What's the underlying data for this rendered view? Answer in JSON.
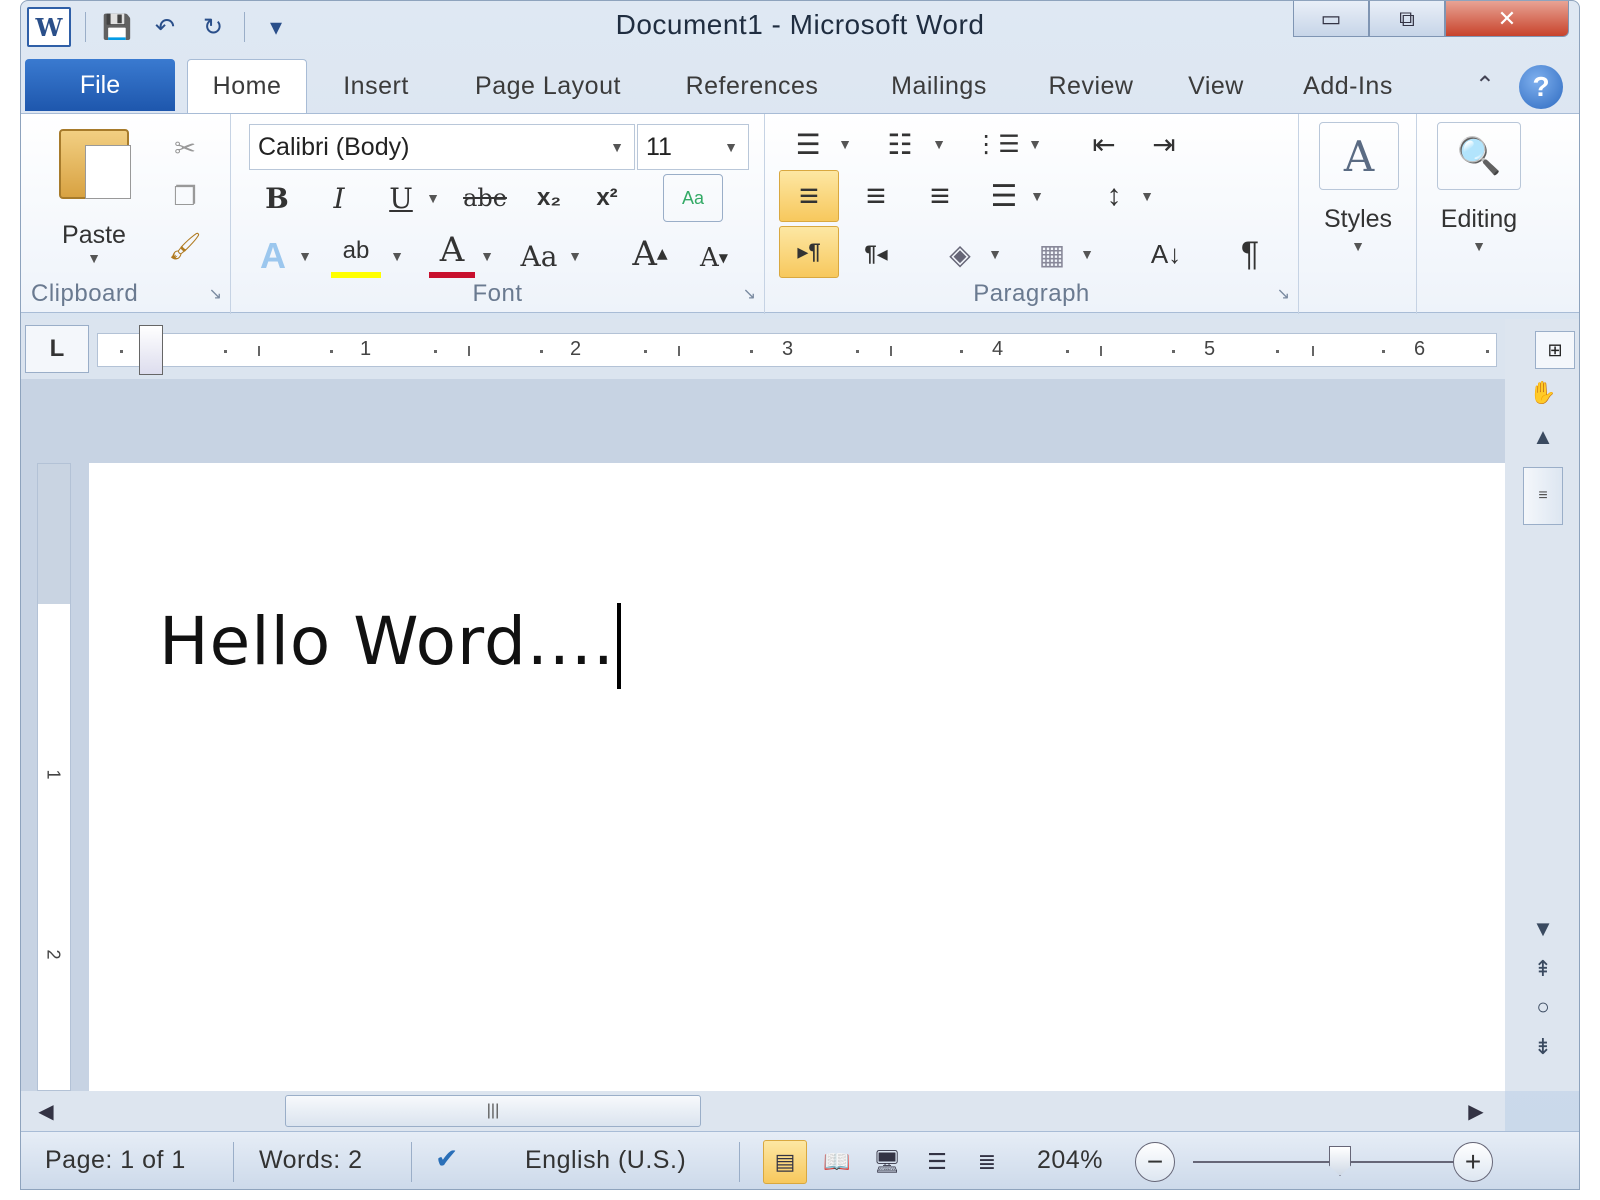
{
  "window": {
    "title": "Document1  -  Microsoft Word",
    "min_glyph": "▭",
    "max_glyph": "⧉",
    "close_glyph": "✕"
  },
  "qat": {
    "logo": "W",
    "save_glyph": "💾",
    "undo_glyph": "↶",
    "redo_glyph": "↻",
    "customize_glyph": "▾"
  },
  "tabs": [
    {
      "label": "File"
    },
    {
      "label": "Home"
    },
    {
      "label": "Insert"
    },
    {
      "label": "Page Layout"
    },
    {
      "label": "References"
    },
    {
      "label": "Mailings"
    },
    {
      "label": "Review"
    },
    {
      "label": "View"
    },
    {
      "label": "Add-Ins"
    }
  ],
  "help_glyph": "?",
  "ribbon": {
    "clipboard": {
      "label": "Clipboard",
      "paste": "Paste",
      "cut_glyph": "✂",
      "copy_glyph": "❐",
      "format_painter_glyph": "🖌"
    },
    "font": {
      "label": "Font",
      "font_name": "Calibri (Body)",
      "font_size": "11",
      "bold": "B",
      "italic": "I",
      "underline": "U",
      "strikethrough": "abe",
      "subscript": "x₂",
      "superscript": "x²",
      "clear_formatting": "Aa",
      "text_effects": "A",
      "highlight": "ab",
      "font_color": "A",
      "change_case": "Aa",
      "grow_font": "A",
      "shrink_font": "A"
    },
    "paragraph": {
      "label": "Paragraph",
      "bullets_glyph": "☰",
      "numbering_glyph": "☷",
      "multilevel_glyph": "⋮☰",
      "decrease_indent_glyph": "⇤",
      "increase_indent_glyph": "⇥",
      "align_left_glyph": "≡",
      "center_glyph": "≡",
      "align_right_glyph": "≡",
      "justify_glyph": "☰",
      "line_spacing_glyph": "↕",
      "ltr_glyph": "▸¶",
      "rtl_glyph": "¶◂",
      "shading_glyph": "◈",
      "borders_glyph": "▦",
      "sort_glyph": "A↓",
      "pilcrow": "¶"
    },
    "styles": {
      "label": "Styles",
      "glyph": "A"
    },
    "editing": {
      "label": "Editing",
      "glyph": "🔍"
    }
  },
  "ruler": {
    "numbers": [
      "1",
      "2",
      "3",
      "4",
      "5",
      "6"
    ],
    "tab_stop": "L"
  },
  "document": {
    "text": "Hello Word...."
  },
  "vertical_ruler": {
    "numbers": [
      "1",
      "2"
    ]
  },
  "scroll": {
    "grip": "|||",
    "up": "▲",
    "down": "▼",
    "left": "◀",
    "right": "▶",
    "prev_page": "⇞",
    "select_browse": "○",
    "next_page": "⇟",
    "pan": "✋",
    "thumb_grip": "≡"
  },
  "status": {
    "page": "Page: 1 of 1",
    "words": "Words: 2",
    "language": "English (U.S.)",
    "zoom": "204%",
    "zoom_minus": "−",
    "zoom_plus": "+",
    "proofing_glyph": "✔",
    "views": [
      "▤",
      "📖",
      "🖥",
      "☰",
      "≣"
    ]
  },
  "colors": {
    "file_tab": "#1e57ad",
    "highlight_yellow": "#fde7a3",
    "font_red": "#c8102e",
    "highlighter_yellow": "#ffff00"
  }
}
